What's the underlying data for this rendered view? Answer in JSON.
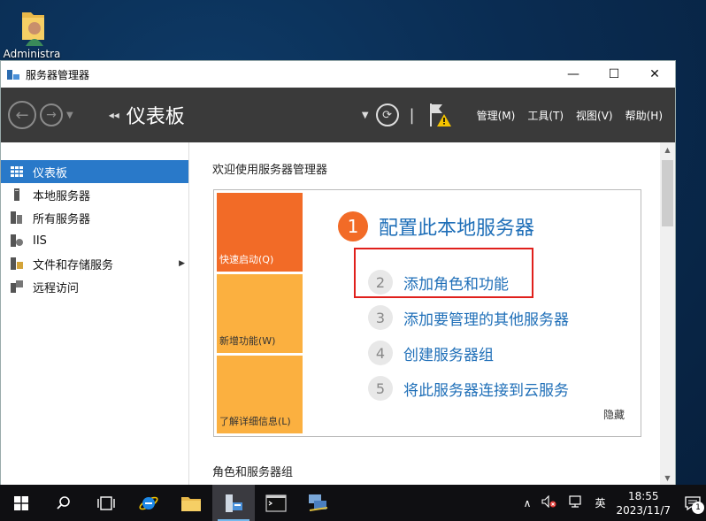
{
  "desktop": {
    "icon_label": "Administra"
  },
  "window": {
    "title": "服务器管理器",
    "minimize": "—",
    "maximize": "☐",
    "close": "✕"
  },
  "toolbar": {
    "breadcrumb_arrows": "◂◂",
    "breadcrumb": "仪表板",
    "menus": [
      "管理(M)",
      "工具(T)",
      "视图(V)",
      "帮助(H)"
    ]
  },
  "sidebar": {
    "items": [
      {
        "label": "仪表板",
        "icon": "dashboard-icon",
        "active": true
      },
      {
        "label": "本地服务器",
        "icon": "server-icon"
      },
      {
        "label": "所有服务器",
        "icon": "servers-icon"
      },
      {
        "label": "IIS",
        "icon": "iis-icon"
      },
      {
        "label": "文件和存储服务",
        "icon": "storage-icon",
        "expandable": true
      },
      {
        "label": "远程访问",
        "icon": "remote-access-icon"
      }
    ]
  },
  "main": {
    "welcome_title": "欢迎使用服务器管理器",
    "tiles": [
      "快速启动(Q)",
      "新增功能(W)",
      "了解详细信息(L)"
    ],
    "steps": [
      {
        "num": "1",
        "label": "配置此本地服务器"
      },
      {
        "num": "2",
        "label": "添加角色和功能"
      },
      {
        "num": "3",
        "label": "添加要管理的其他服务器"
      },
      {
        "num": "4",
        "label": "创建服务器组"
      },
      {
        "num": "5",
        "label": "将此服务器连接到云服务"
      }
    ],
    "hide_label": "隐藏",
    "roles_title": "角色和服务器组"
  },
  "taskbar": {
    "tray_ime": "英",
    "time": "18:55",
    "date": "2023/11/7",
    "notification_count": "1"
  },
  "colors": {
    "accent": "#2979c9",
    "tile_orange": "#f26b27",
    "tile_yellow": "#fbb040",
    "highlight": "#e0201c"
  }
}
